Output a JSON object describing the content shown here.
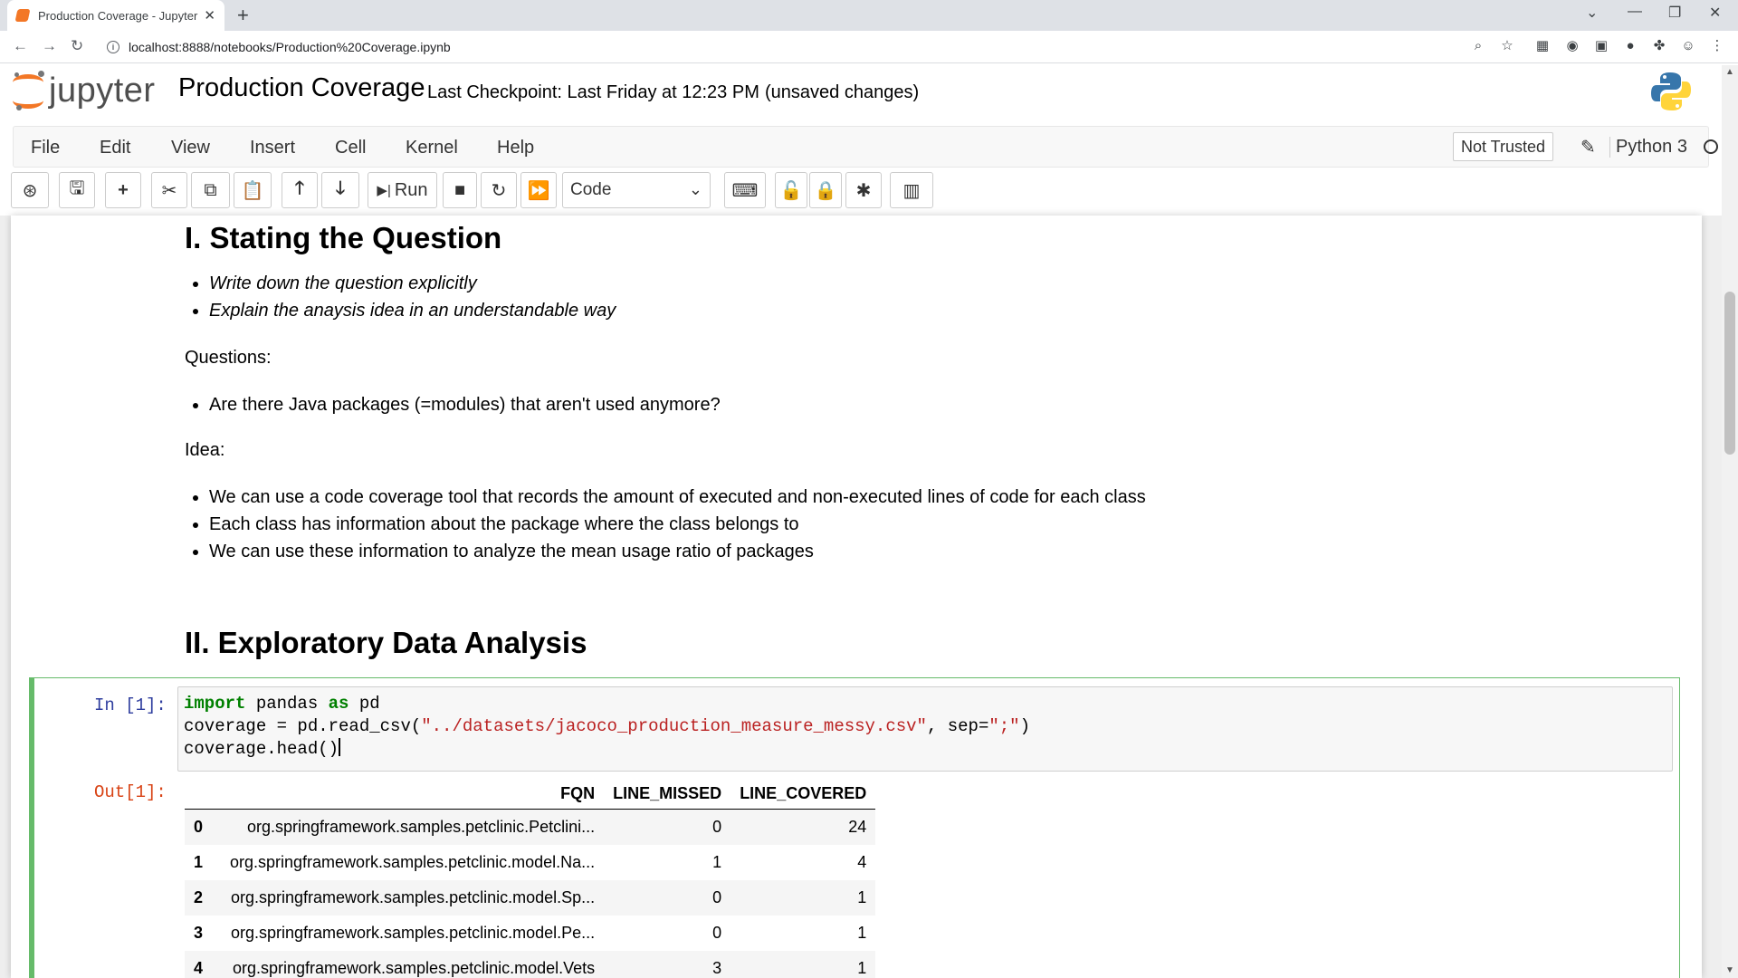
{
  "browser": {
    "tab_title": "Production Coverage - Jupyter N",
    "tab_close": "✕",
    "new_tab": "+",
    "url": "localhost:8888/notebooks/Production%20Coverage.ipynb",
    "info_icon": "i",
    "window_controls": {
      "minimize": "—",
      "restore": "❐",
      "close": "✕"
    }
  },
  "header": {
    "logo_text": "jupyter",
    "notebook_name": "Production Coverage",
    "checkpoint": "Last Checkpoint: Last Friday at 12:23 PM",
    "unsaved": "(unsaved changes)"
  },
  "menubar": {
    "items": [
      "File",
      "Edit",
      "View",
      "Insert",
      "Cell",
      "Kernel",
      "Help"
    ],
    "trust": "Not Trusted",
    "kernel": "Python 3"
  },
  "toolbar": {
    "run_label": "Run",
    "cell_type": "Code",
    "icons": [
      "keyboard-icon",
      "save-icon",
      "plus-icon",
      "cut-icon",
      "copy-icon",
      "paste-icon",
      "arrow-up-icon",
      "arrow-down-icon",
      "run-icon",
      "stop-icon",
      "restart-icon",
      "fast-forward-icon",
      "command-palette-icon",
      "unlock-icon",
      "lock-icon",
      "asterisk-icon",
      "bar-chart-icon"
    ]
  },
  "notebook": {
    "section1": {
      "title": "I. Stating the Question",
      "goals": [
        "Write down the question explicitly",
        "Explain the anaysis idea in an understandable way"
      ],
      "questions_label": "Questions:",
      "questions": [
        "Are there Java packages (=modules) that aren't used anymore?"
      ],
      "idea_label": "Idea:",
      "ideas": [
        "We can use a code coverage tool that records the amount of executed and non-executed lines of code for each class",
        "Each class has information about the package where the class belongs to",
        "We can use these information to analyze the mean usage ratio of packages"
      ]
    },
    "section2": {
      "title": "II. Exploratory Data Analysis"
    },
    "cell": {
      "in_prompt": "In [1]:",
      "out_prompt": "Out[1]:",
      "code": {
        "l1_kw1": "import",
        "l1_mid": " pandas ",
        "l1_kw2": "as",
        "l1_end": " pd",
        "l2_start": "coverage = pd.read_csv(",
        "l2_str1": "\"../datasets/jacoco_production_measure_messy.csv\"",
        "l2_mid": ", sep=",
        "l2_str2": "\";\"",
        "l2_end": ")",
        "l3": "coverage.head()"
      },
      "table": {
        "columns": [
          "",
          "FQN",
          "LINE_MISSED",
          "LINE_COVERED"
        ],
        "rows": [
          [
            "0",
            "org.springframework.samples.petclinic.Petclini...",
            "0",
            "24"
          ],
          [
            "1",
            "org.springframework.samples.petclinic.model.Na...",
            "1",
            "4"
          ],
          [
            "2",
            "org.springframework.samples.petclinic.model.Sp...",
            "0",
            "1"
          ],
          [
            "3",
            "org.springframework.samples.petclinic.model.Pe...",
            "0",
            "1"
          ],
          [
            "4",
            "org.springframework.samples.petclinic.model.Vets",
            "3",
            "1"
          ]
        ]
      }
    }
  },
  "colors": {
    "jupyter_orange": "#f37726",
    "cell_selected_border": "#66bb6a",
    "in_prompt": "#303f9f",
    "out_prompt": "#d84315",
    "keyword": "#008000",
    "string": "#ba2121"
  }
}
